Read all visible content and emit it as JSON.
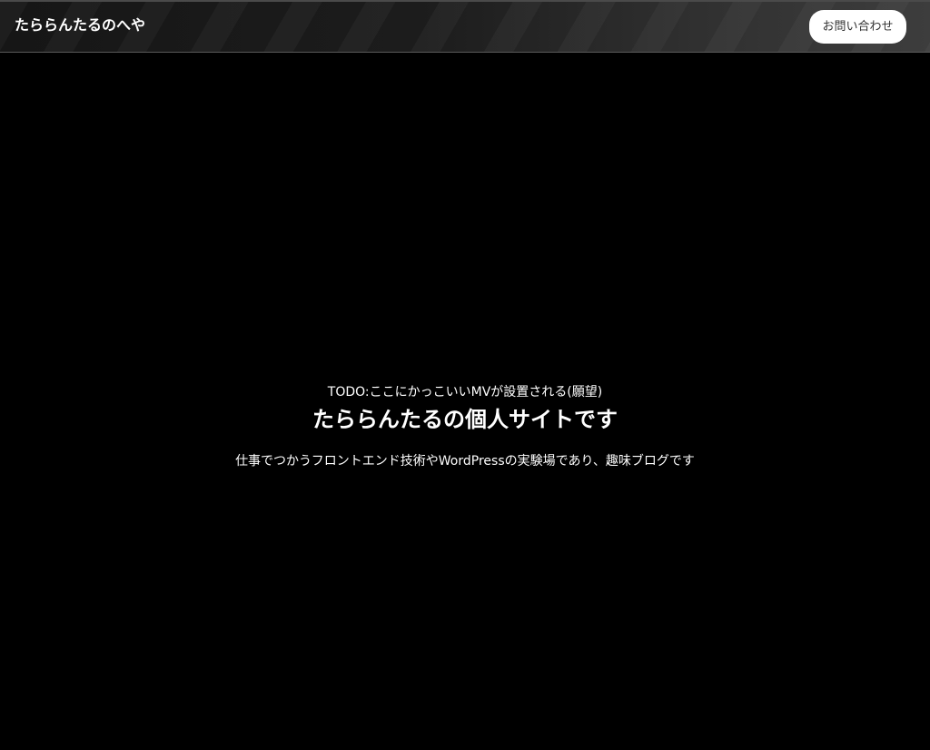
{
  "header": {
    "site_title": "たららんたるのへや",
    "contact_label": "お問い合わせ"
  },
  "hero": {
    "todo_text": "TODO:ここにかっこいいMVが設置される(願望)",
    "title": "たららんたるの個人サイトです",
    "description": "仕事でつかうフロントエンド技術やWordPressの実験場であり、趣味ブログです"
  },
  "colors": {
    "background": "#000000",
    "header_gradient_start": "#161616",
    "header_gradient_end": "#3d3d3d",
    "text": "#ffffff",
    "button_background": "#ffffff",
    "button_text": "#333333"
  }
}
